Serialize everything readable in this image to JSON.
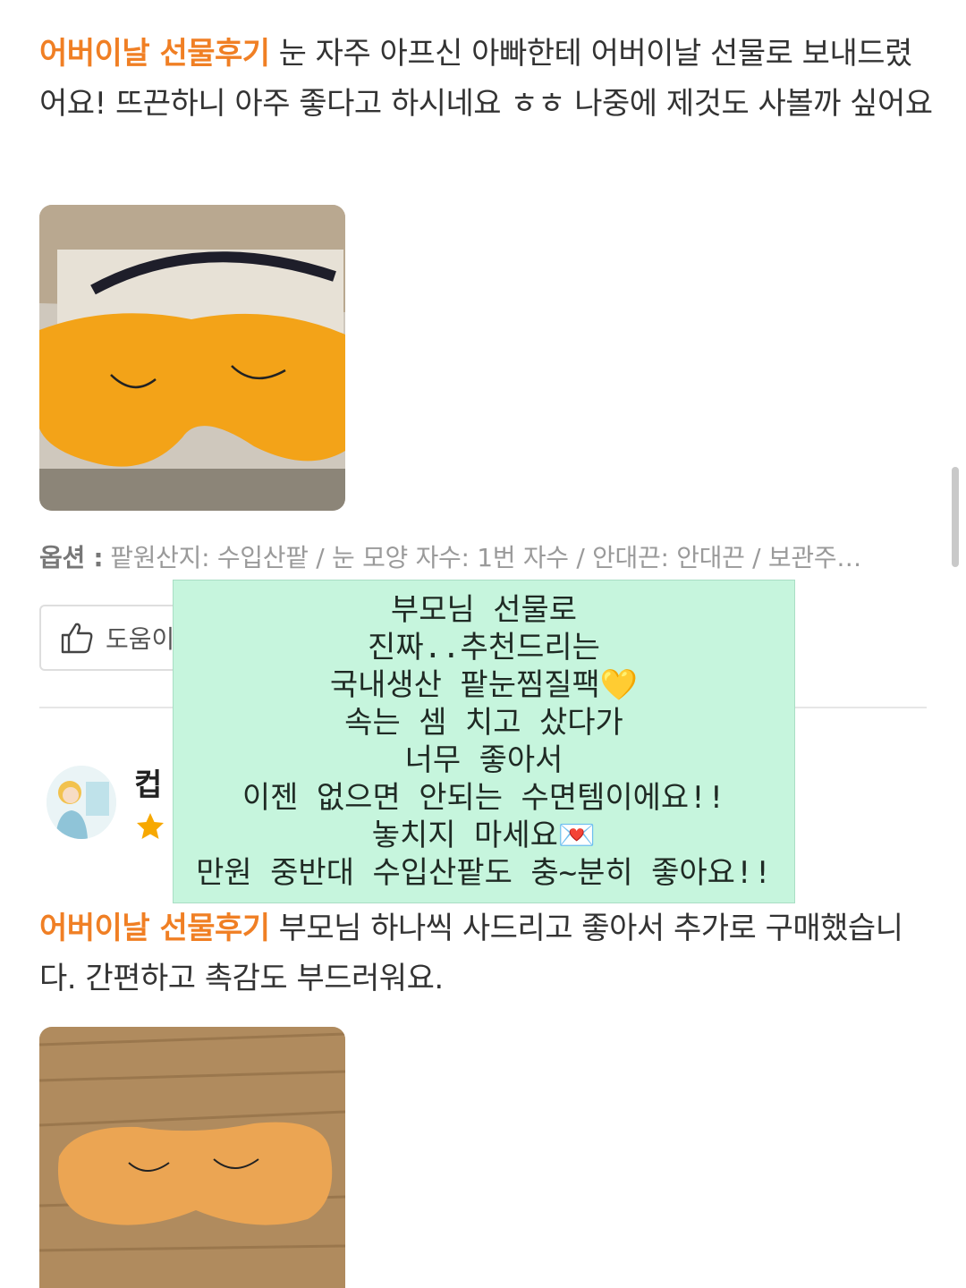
{
  "reviews": [
    {
      "tag": "어버이날 선물후기",
      "text": "눈 자주 아프신 아빠한테 어버이날 선물로 보내드렸어요! 뜨끈하니 아주 좋다고 하시네요 ㅎㅎ 나중에 제것도 사볼까 싶어요",
      "options_label": "옵션 :",
      "options_text": "팥원산지: 수입산팥 / 눈 모양 자수: 1번 자수 / 안대끈: 안대끈 / 보관주…",
      "helpful_label": "도움이"
    },
    {
      "reviewer_name": "컵",
      "tag": "어버이날 선물후기",
      "text": "부모님 하나씩 사드리고 좋아서 추가로 구매했습니다. 간편하고 촉감도 부드러워요."
    }
  ],
  "overlay": {
    "lines": [
      "부모님 선물로",
      "진짜..추천드리는",
      "국내생산 팥눈찜질팩💛",
      "속는 셈 치고 샀다가",
      "너무 좋아서",
      "이젠 없으면 안되는 수면템이에요!!",
      "놓치지 마세요💌",
      "만원 중반대 수입산팥도 충~분히 좋아요!!"
    ]
  },
  "icons": {
    "thumbs_up": "thumbs-up-icon",
    "star": "star-icon"
  },
  "colors": {
    "tag": "#f07f24",
    "overlay_bg": "#c6f5dd",
    "star": "#f7a800"
  }
}
